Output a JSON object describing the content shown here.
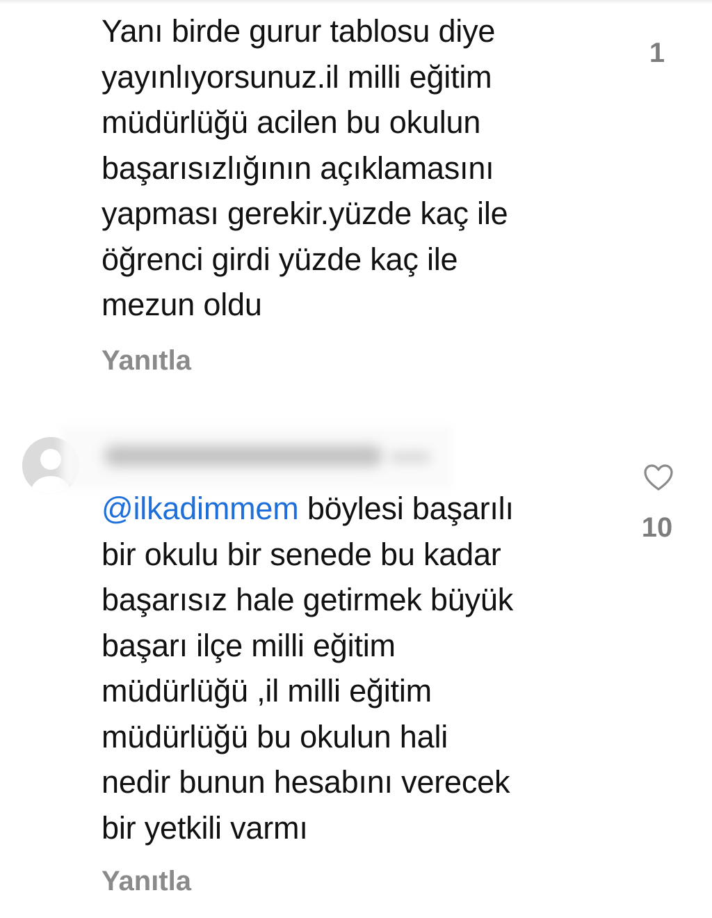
{
  "comments": [
    {
      "text": "Yanı birde gurur tablosu diye\nyayınlıyorsunuz.il milli eğitim\nmüdürlüğü acilen bu okulun\nbaşarısızlığının açıklamasını\nyapması gerekir.yüzde kaç ile\nöğrenci girdi yüzde kaç ile\nmezun oldu",
      "reply_label": "Yanıtla",
      "like_count": "1"
    },
    {
      "mention": "@ilkadimmem",
      "text": " böylesi başarılı\nbir okulu bir senede bu kadar\nbaşarısız hale getirmek büyük\nbaşarı ilçe milli eğitim\nmüdürlüğü ,il milli eğitim\nmüdürlüğü bu okulun hali\nnedir bunun hesabını verecek\nbir yetkili varmı",
      "reply_label": "Yanıtla",
      "like_count": "10"
    }
  ],
  "icons": {
    "like": "heart-outline-icon",
    "avatar": "default-avatar-icon"
  },
  "colors": {
    "mention": "#1e6fd9",
    "secondary_text": "#8a8a8a",
    "primary_text": "#111111"
  }
}
